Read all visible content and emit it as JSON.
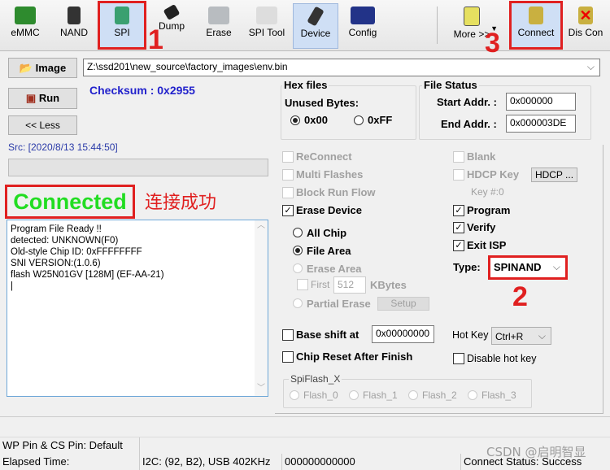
{
  "toolbar": {
    "items": [
      {
        "label": "eMMC",
        "icon": "emmc-chip-icon"
      },
      {
        "label": "NAND",
        "icon": "nand-chip-icon"
      },
      {
        "label": "SPI",
        "icon": "spi-board-icon"
      },
      {
        "label": "Dump",
        "icon": "dump-icon"
      },
      {
        "label": "Erase",
        "icon": "erase-icon"
      },
      {
        "label": "SPI Tool",
        "icon": "spi-tool-icon"
      },
      {
        "label": "Device",
        "icon": "device-icon"
      },
      {
        "label": "Config",
        "icon": "config-icon"
      },
      {
        "label": "More >>",
        "icon": "tv-icon"
      },
      {
        "label": "Connect",
        "icon": "connect-icon"
      },
      {
        "label": "Dis Con",
        "icon": "disconnect-icon"
      }
    ]
  },
  "annotations": {
    "n1": "1",
    "n2": "2",
    "n3": "3",
    "success_cn": "连接成功"
  },
  "image_button": "Image",
  "image_path": "Z:\\ssd201\\new_source\\factory_images\\env.bin",
  "checksum": "Checksum : 0x2955",
  "run_button": "Run",
  "less_button": "<< Less",
  "src": "Src: [2020/8/13 15:44:50]",
  "connected": "Connected",
  "log": [
    "Program File Ready !!",
    "detected: UNKNOWN(F0)",
    "Old-style Chip ID: 0xFFFFFFFF",
    "SNI VERSION:(1.0.6)",
    "flash W25N01GV [128M] (EF-AA-21)"
  ],
  "hex": {
    "title": "Hex files",
    "unused": "Unused Bytes:",
    "opt1": "0x00",
    "opt2": "0xFF",
    "selected": "0x00"
  },
  "file_status": {
    "title": "File Status",
    "start_label": "Start Addr. :",
    "start": "0x000000",
    "end_label": "End Addr. :",
    "end": "0x000003DE"
  },
  "options": {
    "reconnect": "ReConnect",
    "multi": "Multi Flashes",
    "block": "Block Run Flow",
    "erase_device": "Erase Device",
    "all_chip": "All Chip",
    "file_area": "File Area",
    "erase_area": "Erase Area",
    "first": "First",
    "first_val": "512",
    "kbytes": "KBytes",
    "partial": "Partial Erase",
    "setup": "Setup",
    "base_shift": "Base shift at",
    "base_val": "0x00000000",
    "chip_reset": "Chip Reset After Finish",
    "spiflash": "SpiFlash_X",
    "flashes": [
      "Flash_0",
      "Flash_1",
      "Flash_2",
      "Flash_3"
    ],
    "blank": "Blank",
    "hdcp": "HDCP Key",
    "hdcp_btn": "HDCP ...",
    "key": "Key #:0",
    "program": "Program",
    "verify": "Verify",
    "exit_isp": "Exit ISP",
    "type_label": "Type:",
    "type": "SPINAND",
    "hotkey_label": "Hot Key",
    "hotkey": "Ctrl+R",
    "disable_hotkey": "Disable hot key"
  },
  "status": {
    "wp": "WP Pin & CS Pin: Default",
    "elapsed": "Elapsed Time:",
    "i2c": "I2C: (92, B2), USB  402KHz",
    "counter": "000000000000",
    "connect_status": "Connect Status: Success"
  },
  "watermark": "CSDN @启明智显",
  "colors": {
    "connected": "#22dd22",
    "checksum": "#2222cc",
    "annotation": "#e02020"
  }
}
